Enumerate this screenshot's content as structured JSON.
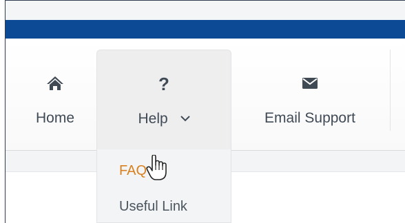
{
  "nav": {
    "items": [
      {
        "label": "Home",
        "icon": "home-icon"
      },
      {
        "label": "Help",
        "icon": "question-mark-icon",
        "icon_text": "?",
        "expanded": true
      },
      {
        "label": "Email Support",
        "icon": "envelope-icon"
      }
    ]
  },
  "dropdown": {
    "items": [
      {
        "label": "FAQ",
        "hovered": true
      },
      {
        "label": "Useful Link"
      }
    ]
  },
  "colors": {
    "brand_bar": "#0d4a96",
    "text": "#404a55",
    "hover_link": "#d9801e"
  }
}
